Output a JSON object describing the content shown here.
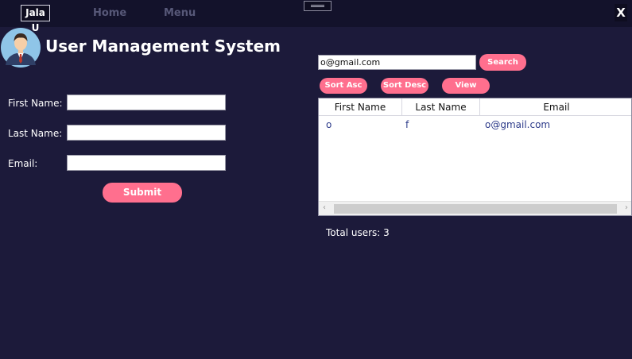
{
  "topbar": {
    "brand": "Jala U",
    "nav": [
      "Home",
      "Menu"
    ],
    "close_label": "X"
  },
  "app": {
    "title": "User Management System"
  },
  "form": {
    "first_name_label": "First Name:",
    "last_name_label": "Last Name:",
    "email_label": "Email:",
    "first_name_value": "",
    "last_name_value": "",
    "email_value": "",
    "submit_label": "Submit"
  },
  "search": {
    "value": "o@gmail.com",
    "button_label": "Search"
  },
  "actions": {
    "sort_asc": "Sort Asc",
    "sort_desc": "Sort Desc",
    "view_errors": "View Errors"
  },
  "table": {
    "columns": [
      "First Name",
      "Last Name",
      "Email"
    ],
    "rows": [
      {
        "first": "o",
        "last": "f",
        "email": "o@gmail.com"
      }
    ]
  },
  "footer": {
    "total": "Total users: 3"
  },
  "colors": {
    "background": "#1c1a3a",
    "accent": "#ff6f8e",
    "topbar": "#13122b"
  }
}
